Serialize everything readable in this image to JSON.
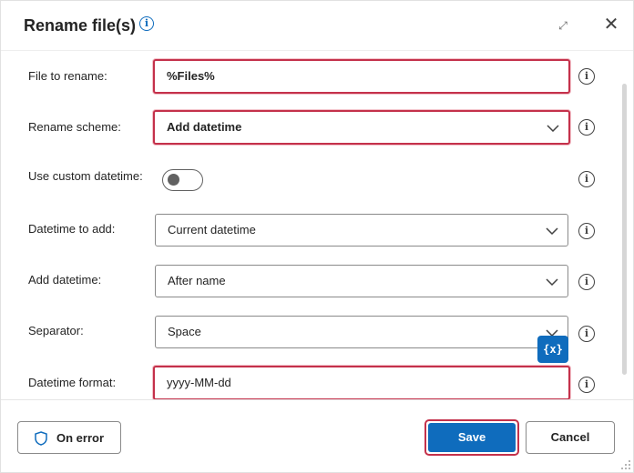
{
  "dialog": {
    "title": "Rename file(s)",
    "info_glyph": "i",
    "expand_glyph": "⤢",
    "close_glyph": "✕"
  },
  "form": {
    "file_to_rename": {
      "label": "File to rename:",
      "value": "%Files%"
    },
    "rename_scheme": {
      "label": "Rename scheme:",
      "value": "Add datetime"
    },
    "use_custom_datetime": {
      "label": "Use custom datetime:",
      "enabled": false
    },
    "datetime_to_add": {
      "label": "Datetime to add:",
      "value": "Current datetime"
    },
    "add_datetime": {
      "label": "Add datetime:",
      "value": "After name"
    },
    "separator": {
      "label": "Separator:",
      "value": "Space"
    },
    "datetime_format": {
      "label": "Datetime format:",
      "value": "yyyy-MM-dd"
    },
    "variable_button": "{x}"
  },
  "footer": {
    "on_error": "On error",
    "save": "Save",
    "cancel": "Cancel"
  },
  "icons": {
    "info": "info-icon",
    "chevron": "chevron-down-icon",
    "shield": "shield-icon",
    "expand": "expand-icon",
    "close": "close-icon"
  },
  "colors": {
    "accent": "#0f6cbd",
    "highlight": "#c4314b"
  }
}
